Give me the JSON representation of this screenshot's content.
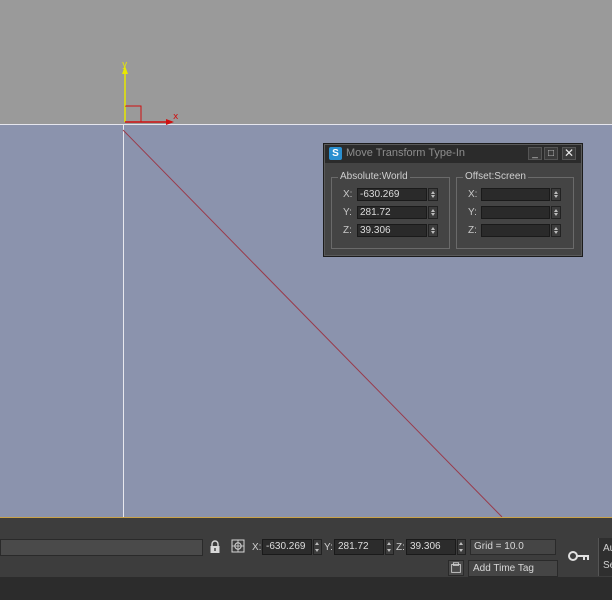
{
  "gizmo": {
    "x_axis_label": "x",
    "y_axis_label": "y"
  },
  "dialog": {
    "title": "Move Transform Type-In",
    "absolute": {
      "title": "Absolute:World",
      "x_label": "X:",
      "x_value": "-630.269",
      "y_label": "Y:",
      "y_value": "281.72",
      "z_label": "Z:",
      "z_value": "39.306"
    },
    "offset": {
      "title": "Offset:Screen",
      "x_label": "X:",
      "x_value": "",
      "y_label": "Y:",
      "y_value": "",
      "z_label": "Z:",
      "z_value": ""
    }
  },
  "statusbar": {
    "x_label": "X:",
    "x_value": "-630.269",
    "y_label": "Y:",
    "y_value": "281.72",
    "z_label": "Z:",
    "z_value": "39.306",
    "grid": "Grid = 10.0",
    "time_tag": "Add Time Tag",
    "right_top": "Au",
    "right_bottom": "Se"
  },
  "icons": [
    "lock-icon",
    "absolute-mode-icon",
    "key-icon",
    "time-tag-icon",
    "app-icon",
    "minimize-icon",
    "maximize-icon",
    "close-icon"
  ],
  "colors": {
    "viewport_bg": "#8b93ad",
    "viewport_top": "#9a9a9a",
    "dialog_bg": "#444444",
    "statusbar_bg": "#3d3d3d"
  }
}
